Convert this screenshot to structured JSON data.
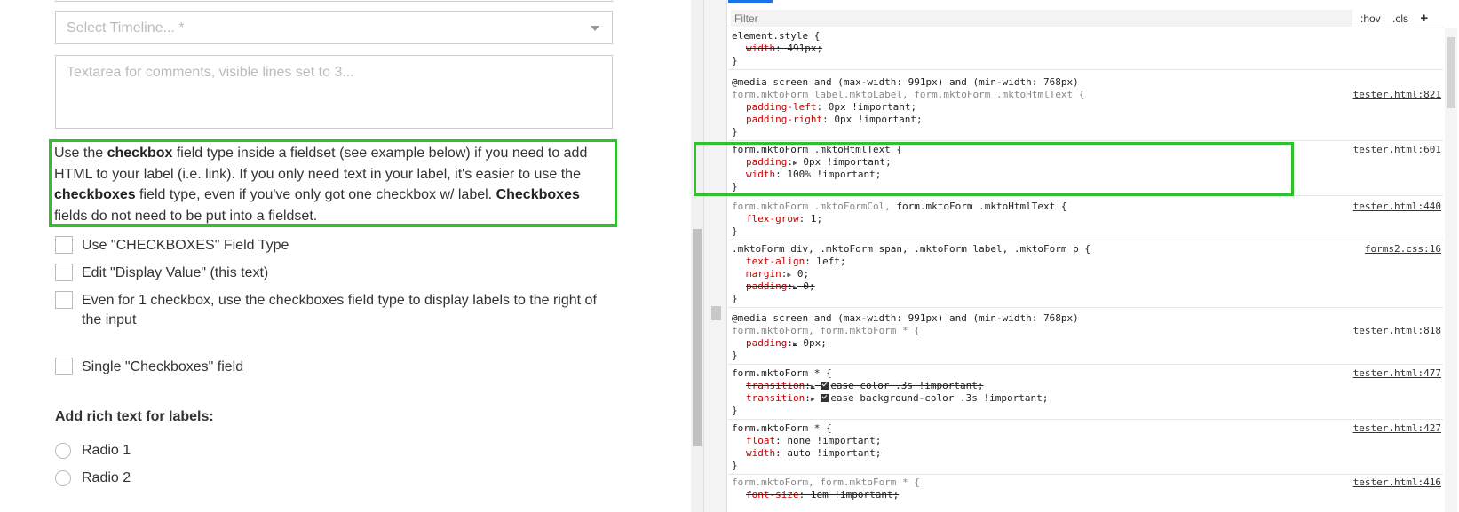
{
  "form": {
    "select_placeholder": "Select Timeline... *",
    "textarea_placeholder": "Textarea for comments, visible lines set to 3...",
    "html_text": {
      "p1": "Use the ",
      "b1": "checkbox",
      "p2": " field type inside a fieldset (see example below) if you need to add HTML to your label (i.e. link). If you only need text in your label, it's easier to use the ",
      "b2": "checkboxes",
      "p3": " field type, even if you've only got one checkbox w/ label. ",
      "b3": "Checkboxes",
      "p4": " fields do not need to be put into a fieldset."
    },
    "checkboxes": [
      "Use \"CHECKBOXES\" Field Type",
      "Edit \"Display Value\" (this text)",
      "Even for 1 checkbox, use the checkboxes field type to display labels to the right of the input"
    ],
    "single_checkbox": "Single \"Checkboxes\" field",
    "rich_heading": "Add rich text for labels:",
    "radios": [
      "Radio 1",
      "Radio 2"
    ]
  },
  "devtools": {
    "filter_placeholder": "Filter",
    "hov": ":hov",
    "cls": ".cls",
    "plus": "+",
    "r1": {
      "sel": "element.style {",
      "p1n": "width",
      "p1v": ": 491px;",
      "close": "}"
    },
    "r2": {
      "media": "@media screen and (max-width: 991px) and (min-width: 768px)",
      "sel": "form.mktoForm label.mktoLabel, form.mktoForm .mktoHtmlText {",
      "src": "tester.html:821",
      "p1n": "padding-left",
      "p1v": ": 0px !important;",
      "p2n": "padding-right",
      "p2v": ": 0px !important;",
      "close": "}"
    },
    "r3": {
      "sel": "form.mktoForm .mktoHtmlText {",
      "src": "tester.html:601",
      "p1n": "padding",
      "p1v": " 0px !important;",
      "p2n": "width",
      "p2v": ": 100% !important;",
      "close": "}"
    },
    "r4": {
      "sel_muted": "form.mktoForm .mktoFormCol, ",
      "sel": "form.mktoForm .mktoHtmlText {",
      "src": "tester.html:440",
      "p1n": "flex-grow",
      "p1v": ": 1;",
      "close": "}"
    },
    "r5": {
      "sel": ".mktoForm div, .mktoForm span, .mktoForm label, .mktoForm p {",
      "src": "forms2.css:16",
      "p1n": "text-align",
      "p1v": ": left;",
      "p2n": "margin",
      "p2v": " 0;",
      "p3n": "padding",
      "p3v": " 0;",
      "close": "}"
    },
    "r6": {
      "media": "@media screen and (max-width: 991px) and (min-width: 768px)",
      "sel": "form.mktoForm, form.mktoForm * {",
      "src": "tester.html:818",
      "p1n": "padding",
      "p1v": " 0px;",
      "close": "}"
    },
    "r7": {
      "sel": "form.mktoForm * {",
      "src": "tester.html:477",
      "p1n": "transition",
      "p1v": "ease color .3s !important;",
      "p2n": "transition",
      "p2v": "ease background-color .3s !important;",
      "close": "}"
    },
    "r8": {
      "sel": "form.mktoForm * {",
      "src": "tester.html:427",
      "p1n": "float",
      "p1v": ": none !important;",
      "p2n": "width",
      "p2v": ": auto !important;",
      "close": "}"
    },
    "r9": {
      "sel": "form.mktoForm, form.mktoForm * {",
      "src": "tester.html:416",
      "p1n": "font-size",
      "p1v": ": 1em !important;"
    }
  }
}
